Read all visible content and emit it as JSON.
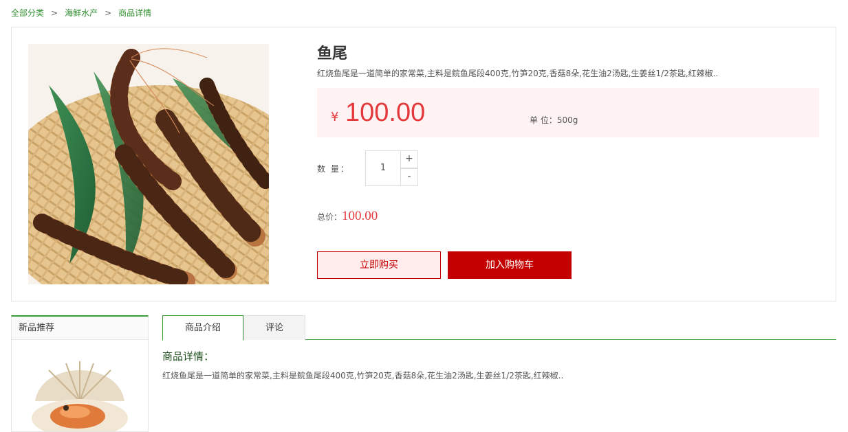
{
  "breadcrumb": {
    "items": [
      "全部分类",
      "海鲜水产",
      "商品详情"
    ],
    "separator": ">"
  },
  "product": {
    "image_icon": "prawn-photo",
    "title": "鱼尾",
    "description": "红烧鱼尾是一道简单的家常菜,主料是鲩鱼尾段400克,竹笋20克,香菇8朵,花生油2汤匙,生姜丝1/2茶匙,红辣椒..",
    "currency": "¥",
    "price": "100.00",
    "unit_label": "单 位：500g",
    "quantity_label": "数 量：",
    "quantity": "1",
    "plus": "+",
    "minus": "-",
    "total_label": "总价：",
    "total": "100.00",
    "buy_now": "立即购买",
    "add_to_cart": "加入购物车"
  },
  "sidebar": {
    "title": "新品推荐",
    "image_icon": "scallop-photo"
  },
  "detail": {
    "tabs": [
      "商品介绍",
      "评论"
    ],
    "heading": "商品详情：",
    "text": "红烧鱼尾是一道简单的家常菜,主料是鲩鱼尾段400克,竹笋20克,香菇8朵,花生油2汤匙,生姜丝1/2茶匙,红辣椒.."
  },
  "colors": {
    "accent_green": "#3a9b3a",
    "price_red": "#e4393c",
    "button_red": "#c40000",
    "price_bg": "#fff3f3"
  }
}
